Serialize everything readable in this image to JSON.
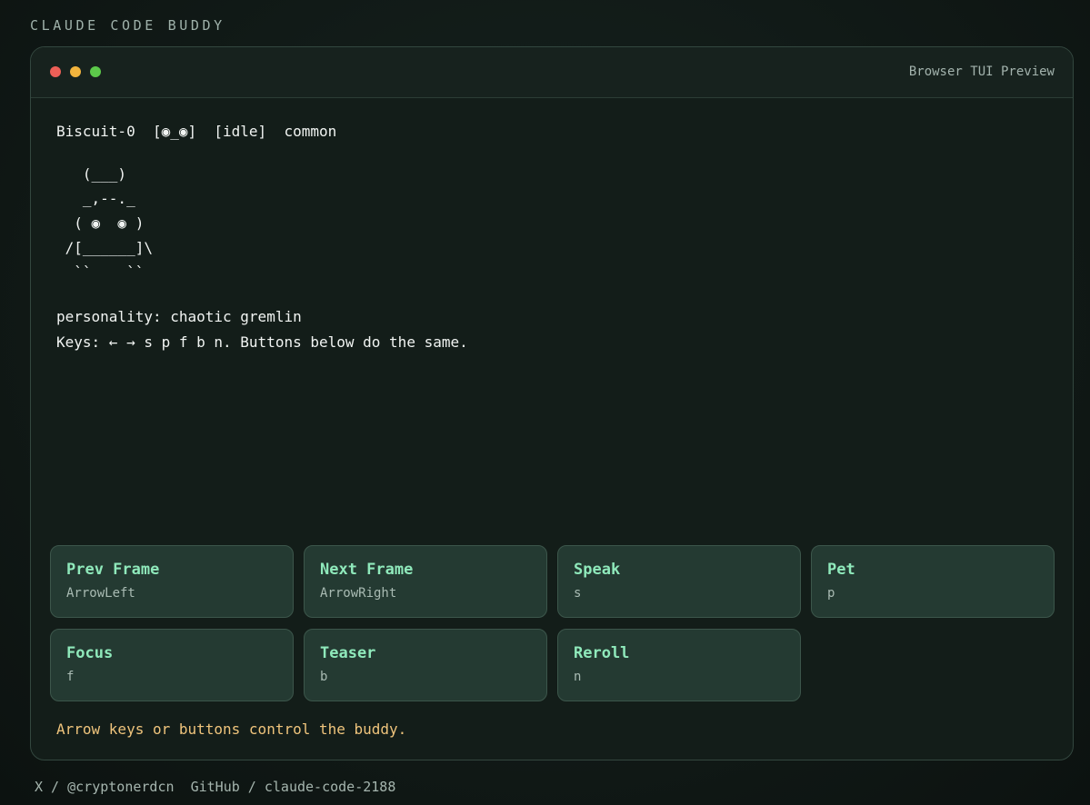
{
  "app": {
    "title": "CLAUDE CODE BUDDY"
  },
  "window": {
    "caption": "Browser TUI Preview",
    "controls": [
      "close",
      "minimize",
      "maximize"
    ]
  },
  "tui": {
    "status_line": "Biscuit-0  [◉_◉]  [idle]  common",
    "ascii_art": "   (___)\n   _,--._\n  ( ◉  ◉ )\n /[______]\\\n  ``    ``",
    "personality": "personality: chaotic gremlin",
    "keys_help": "Keys: ← → s p f b n. Buttons below do the same."
  },
  "buttons": [
    {
      "label": "Prev Frame",
      "key": "ArrowLeft"
    },
    {
      "label": "Next Frame",
      "key": "ArrowRight"
    },
    {
      "label": "Speak",
      "key": "s"
    },
    {
      "label": "Pet",
      "key": "p"
    },
    {
      "label": "Focus",
      "key": "f"
    },
    {
      "label": "Teaser",
      "key": "b"
    },
    {
      "label": "Reroll",
      "key": "n"
    }
  ],
  "hint": "Arrow keys or buttons control the buddy.",
  "footer": {
    "x_link": "X / @cryptonerdcn",
    "github_link": "GitHub / claude-code-2188"
  },
  "colors": {
    "background": "#111a17",
    "accent_green": "#8fe9bb",
    "hint_yellow": "#efc47c",
    "button_bg": "#243a32",
    "dot_red": "#ec5f57",
    "dot_yellow": "#f2b43d",
    "dot_green": "#5cc94a"
  }
}
